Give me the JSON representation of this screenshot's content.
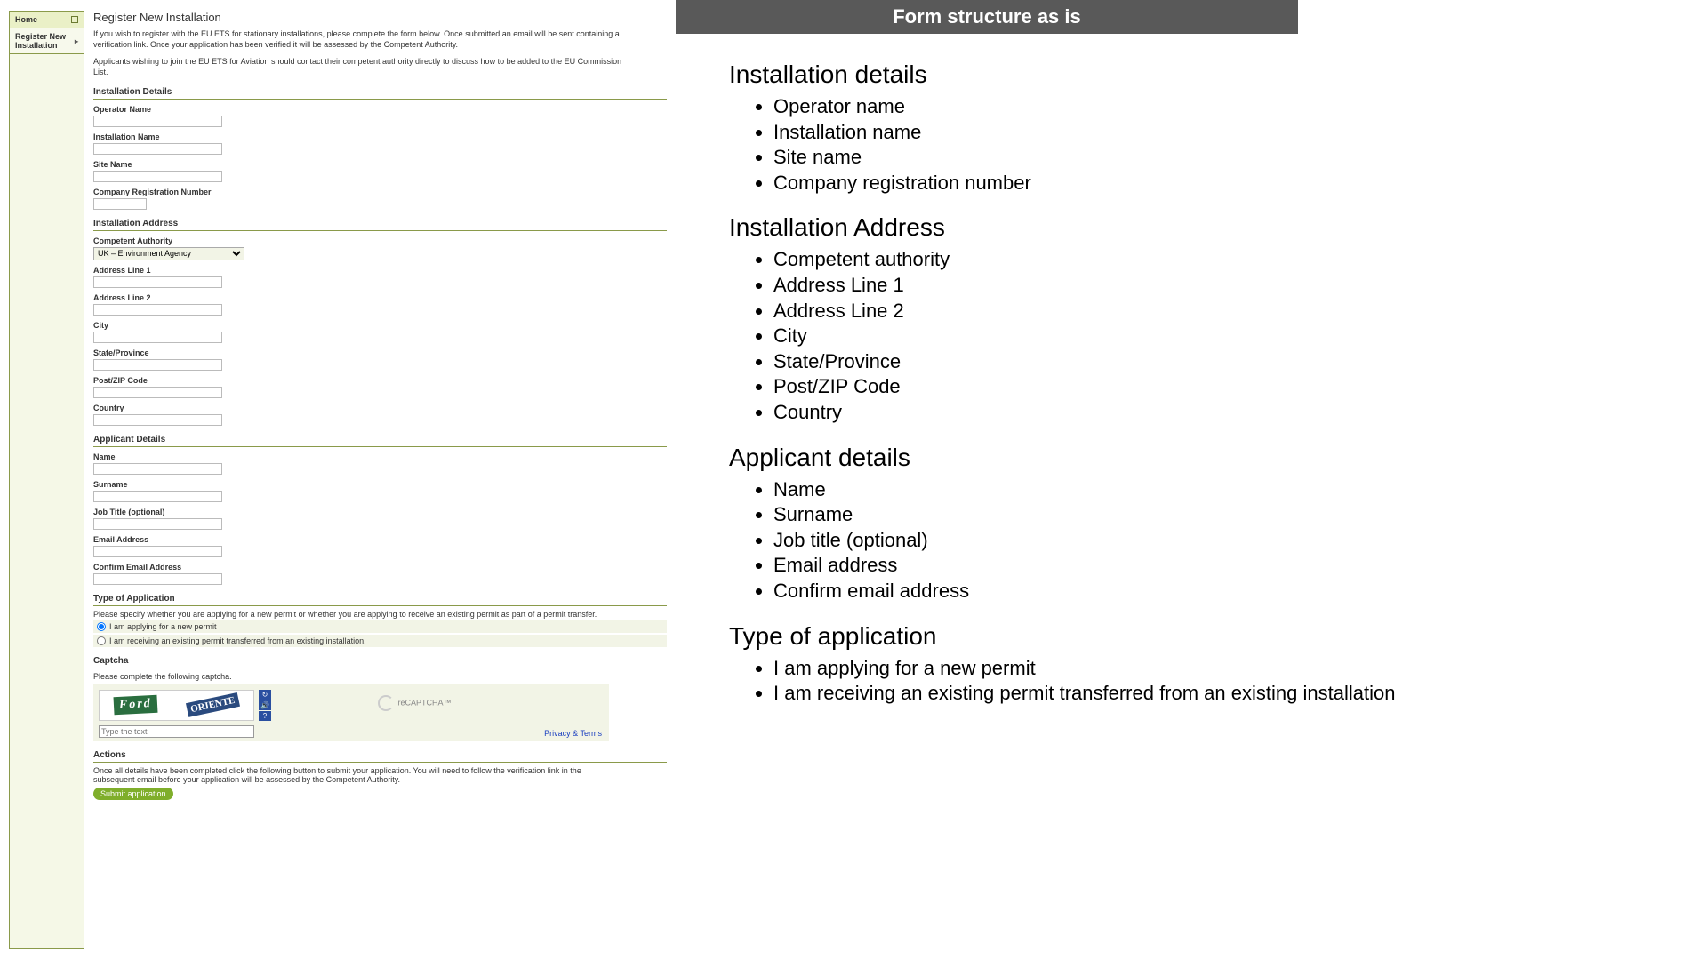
{
  "nav": {
    "home": "Home",
    "register": "Register New Installation"
  },
  "form": {
    "title": "Register New Installation",
    "intro1": "If you wish to register with the EU ETS for stationary installations, please complete the form below. Once submitted an email will be sent containing a verification link. Once your application has been verified it will be assessed by the Competent Authority.",
    "intro2": "Applicants wishing to join the EU ETS for Aviation should contact their competent authority directly to discuss how to be added to the EU Commission List.",
    "sec_installation": "Installation Details",
    "lbl_operator": "Operator Name",
    "lbl_instname": "Installation Name",
    "lbl_site": "Site Name",
    "lbl_crn": "Company Registration Number",
    "sec_address": "Installation Address",
    "lbl_ca": "Competent Authority",
    "ca_value": "UK – Environment Agency",
    "lbl_a1": "Address Line 1",
    "lbl_a2": "Address Line 2",
    "lbl_city": "City",
    "lbl_state": "State/Province",
    "lbl_zip": "Post/ZIP Code",
    "lbl_country": "Country",
    "sec_applicant": "Applicant Details",
    "lbl_name": "Name",
    "lbl_surname": "Surname",
    "lbl_job": "Job Title (optional)",
    "lbl_email": "Email Address",
    "lbl_cemail": "Confirm Email Address",
    "sec_type": "Type of Application",
    "type_note": "Please specify whether you are applying for a new permit or whether you are applying to receive an existing permit as part of a permit transfer.",
    "radio_new": "I am applying for a new permit",
    "radio_existing": "I am receiving an existing permit transferred from an existing installation.",
    "sec_captcha": "Captcha",
    "captcha_note": "Please complete the following captcha.",
    "captcha_w1": "Ford",
    "captcha_w2": "ORIENTE",
    "captcha_ph": "Type the text",
    "recaptcha": "reCAPTCHA™",
    "privacy": "Privacy & Terms",
    "sec_actions": "Actions",
    "actions_note": "Once all details have been completed click the following button to submit your application. You will need to follow the verification link in the subsequent email before your application will be assessed by the Competent Authority.",
    "submit": "Submit application"
  },
  "banner": "Form structure as is",
  "outline": {
    "installation": {
      "title": "Installation details",
      "items": [
        "Operator name",
        "Installation name",
        "Site name",
        "Company registration number"
      ]
    },
    "address": {
      "title": "Installation Address",
      "items": [
        "Competent authority",
        "Address Line 1",
        "Address Line 2",
        "City",
        "State/Province",
        "Post/ZIP Code",
        "Country"
      ]
    },
    "applicant": {
      "title": "Applicant details",
      "items": [
        "Name",
        "Surname",
        "Job title (optional)",
        "Email address",
        "Confirm email address"
      ]
    },
    "type": {
      "title": "Type of application",
      "items": [
        "I am applying for a new permit",
        "I am receiving an existing permit transferred from an existing installation"
      ]
    }
  }
}
